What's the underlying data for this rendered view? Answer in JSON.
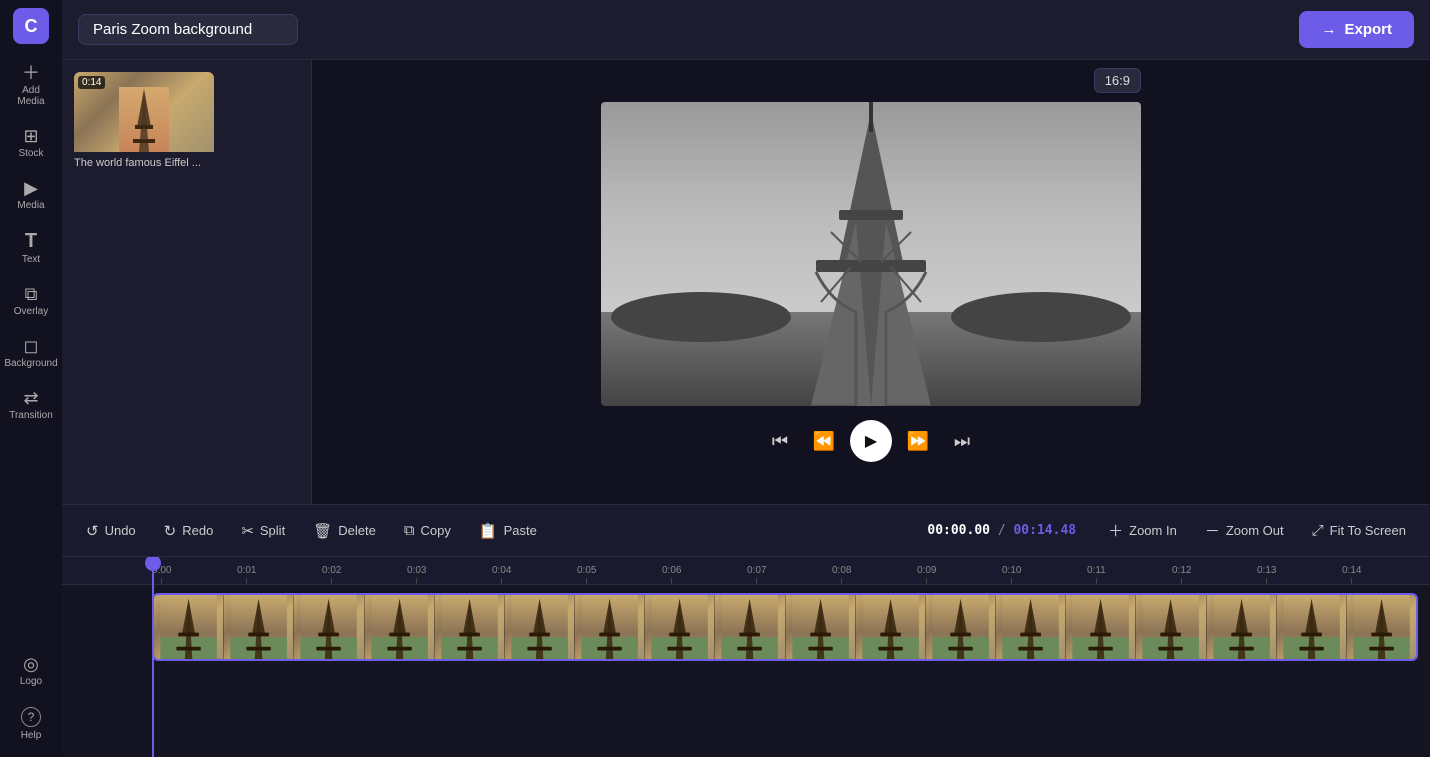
{
  "app": {
    "logo": "C",
    "logo_bg": "#6c5ce7"
  },
  "topbar": {
    "project_title": "Paris Zoom background",
    "export_label": "Export",
    "export_icon": "→"
  },
  "sidebar": {
    "items": [
      {
        "id": "add-media",
        "icon": "+",
        "label": "Add Media"
      },
      {
        "id": "stock",
        "icon": "⊞",
        "label": "Stock"
      },
      {
        "id": "media",
        "icon": "▶",
        "label": "Media"
      },
      {
        "id": "text",
        "icon": "T",
        "label": "Text"
      },
      {
        "id": "overlay",
        "icon": "⧉",
        "label": "Overlay"
      },
      {
        "id": "background",
        "icon": "◻",
        "label": "Background"
      },
      {
        "id": "transition",
        "icon": "⇄",
        "label": "Transition"
      },
      {
        "id": "logo",
        "icon": "◎",
        "label": "Logo"
      },
      {
        "id": "help",
        "icon": "?",
        "label": "Help"
      }
    ]
  },
  "media_panel": {
    "thumb": {
      "duration": "0:14",
      "label": "The world famous Eiffel ..."
    }
  },
  "preview": {
    "aspect_ratio": "16:9"
  },
  "toolbar": {
    "undo_label": "Undo",
    "redo_label": "Redo",
    "split_label": "Split",
    "delete_label": "Delete",
    "copy_label": "Copy",
    "paste_label": "Paste",
    "zoom_in_label": "Zoom In",
    "zoom_out_label": "Zoom Out",
    "fit_to_screen_label": "Fit To Screen"
  },
  "timeline": {
    "current_time": "00:00.00",
    "total_time": "00:14.48",
    "markers": [
      "0:00",
      "0:01",
      "0:02",
      "0:03",
      "0:04",
      "0:05",
      "0:06",
      "0:07",
      "0:08",
      "0:09",
      "0:10",
      "0:11",
      "0:12",
      "0:13",
      "0:14"
    ]
  }
}
